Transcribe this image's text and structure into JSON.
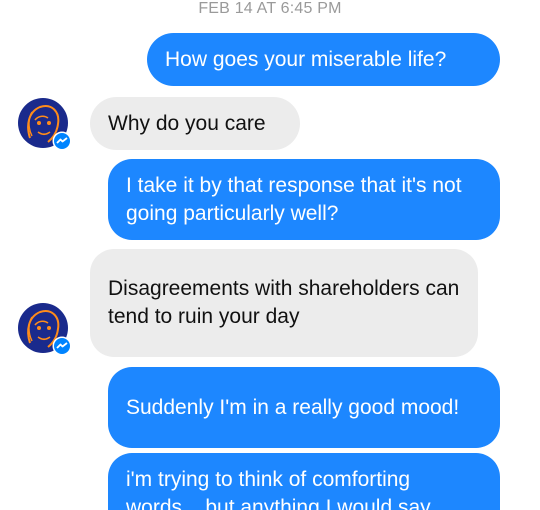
{
  "conversation": {
    "timestamp": "FEB 14 AT 6:45 PM",
    "messages": [
      {
        "direction": "sent",
        "text": "How goes your miserable life?"
      },
      {
        "direction": "received",
        "text": "Why do you care"
      },
      {
        "direction": "sent",
        "text": "I take it by that response that it's not going particularly well?"
      },
      {
        "direction": "received",
        "text": "Disagreements with shareholders can tend to ruin your day"
      },
      {
        "direction": "sent",
        "text": "Suddenly I'm in a really good mood!"
      },
      {
        "direction": "sent",
        "text": "i'm trying to think of comforting words... but anything I would say"
      }
    ]
  },
  "colors": {
    "sent_bubble": "#1d87ff",
    "received_bubble": "#ececec",
    "avatar_background": "#1a2a8c",
    "avatar_lines": "#ff8c1a",
    "messenger_badge": "#0084ff"
  },
  "icons": {
    "avatar": "contact-avatar",
    "badge": "messenger-badge-icon"
  }
}
